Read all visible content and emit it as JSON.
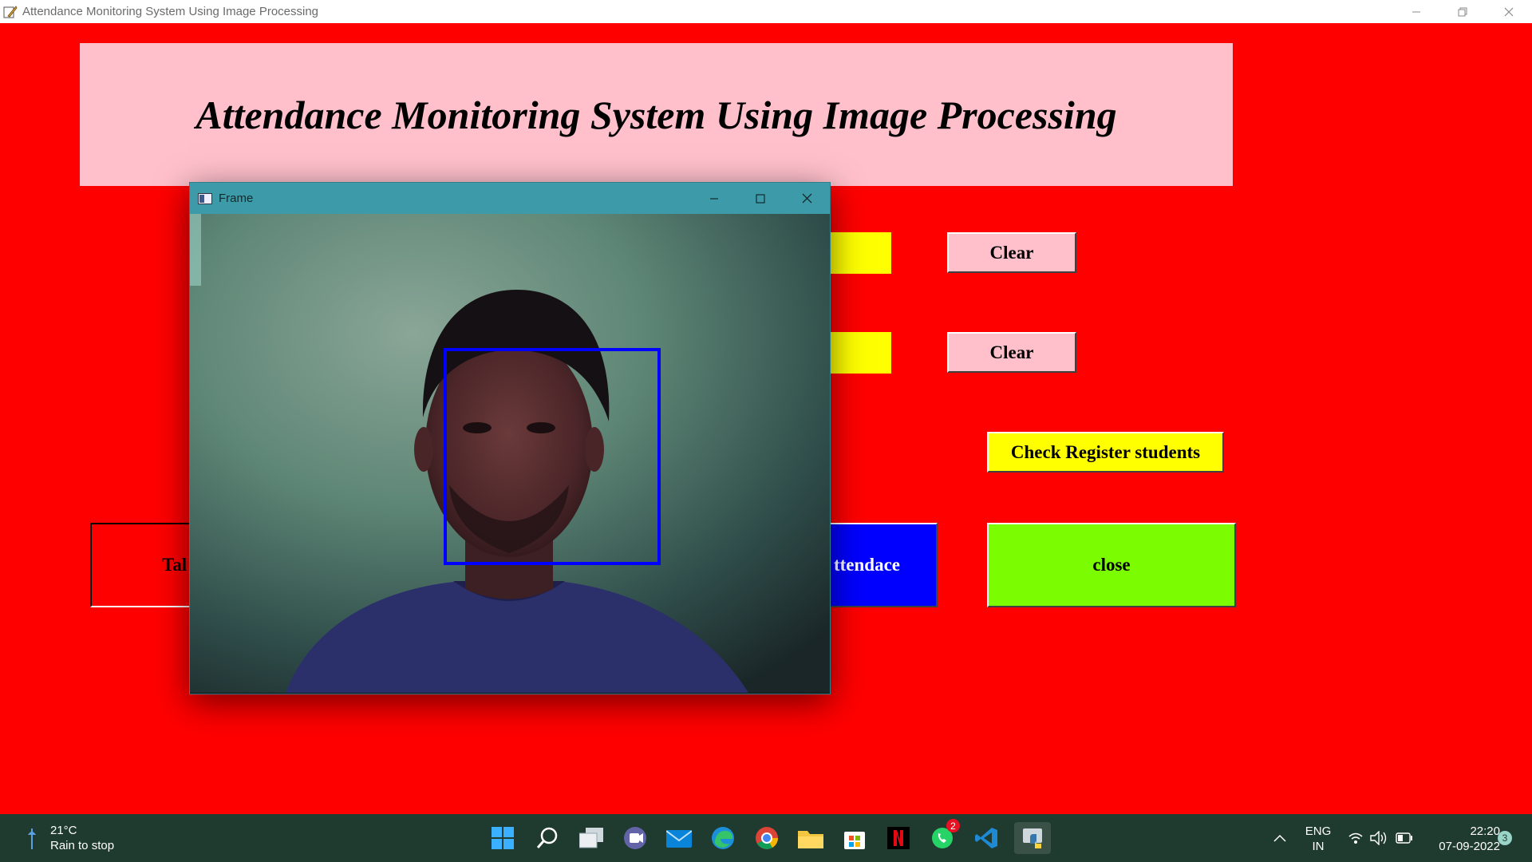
{
  "window": {
    "title": "Attendance Monitoring System Using Image Processing"
  },
  "banner": {
    "text": "Attendance Monitoring System Using Image Processing"
  },
  "buttons": {
    "clear1": "Clear",
    "clear2": "Clear",
    "check_register": "Check Register students",
    "take_images_partial": "Tal",
    "attendance_partial": "ttendace",
    "close": "close"
  },
  "colors": {
    "background": "#ff0000",
    "banner": "#ffc0cb",
    "clear_button": "#ffc0cb",
    "yellow": "#ffff00",
    "blue_button": "#0000ff",
    "green_button": "#7cfc00",
    "face_box": "#0000ff",
    "taskbar": "#1f3a2e"
  },
  "frame_window": {
    "title": "Frame"
  },
  "taskbar": {
    "weather_temp": "21°C",
    "weather_desc": "Rain to stop",
    "lang_line1": "ENG",
    "lang_line2": "IN",
    "time": "22:20",
    "date": "07-09-2022",
    "notification_count": "3",
    "whatsapp_badge": "2",
    "apps": [
      "start-icon",
      "search-icon",
      "task-view-icon",
      "teams-chat-icon",
      "mail-icon",
      "edge-icon",
      "chrome-icon",
      "file-explorer-icon",
      "microsoft-store-icon",
      "netflix-icon",
      "whatsapp-icon",
      "vscode-icon",
      "python-icon"
    ]
  }
}
